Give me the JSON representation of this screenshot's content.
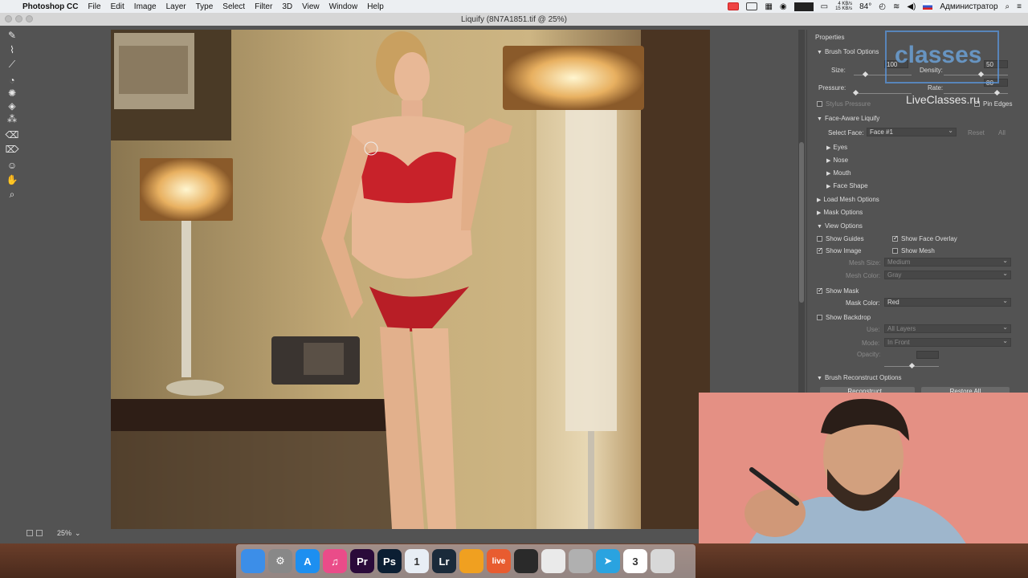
{
  "menubar": {
    "app_name": "Photoshop CC",
    "menus": [
      "File",
      "Edit",
      "Image",
      "Layer",
      "Type",
      "Select",
      "Filter",
      "3D",
      "View",
      "Window",
      "Help"
    ],
    "net_speed_up": "4 KB/s",
    "net_speed_down": "15 KB/s",
    "temperature": "84°",
    "user": "Администратор"
  },
  "window": {
    "title": "Liquify (8N7A1851.tif @ 25%)"
  },
  "zoom": {
    "value": "25%"
  },
  "panel": {
    "title": "Properties",
    "brush": {
      "header": "Brush Tool Options",
      "size_label": "Size:",
      "size_value": "100",
      "density_label": "Density:",
      "density_value": "50",
      "pressure_label": "Pressure:",
      "rate_label": "Rate:",
      "rate_value": "80",
      "stylus_label": "Stylus Pressure",
      "pin_edges_label": "Pin Edges"
    },
    "face_aware": {
      "header": "Face-Aware Liquify",
      "select_face_label": "Select Face:",
      "select_face_value": "Face #1",
      "reset_label": "Reset",
      "all_label": "All",
      "eyes": "Eyes",
      "nose": "Nose",
      "mouth": "Mouth",
      "face_shape": "Face Shape"
    },
    "load_mesh": "Load Mesh Options",
    "mask_options": "Mask Options",
    "view": {
      "header": "View Options",
      "show_guides": "Show Guides",
      "show_face_overlay": "Show Face Overlay",
      "show_image": "Show Image",
      "show_mesh": "Show Mesh",
      "mesh_size_label": "Mesh Size:",
      "mesh_size_value": "Medium",
      "mesh_color_label": "Mesh Color:",
      "mesh_color_value": "Gray",
      "show_mask": "Show Mask",
      "mask_color_label": "Mask Color:",
      "mask_color_value": "Red",
      "show_backdrop": "Show Backdrop",
      "use_label": "Use:",
      "use_value": "All Layers",
      "mode_label": "Mode:",
      "mode_value": "In Front",
      "opacity_label": "Opacity:"
    },
    "reconstruct": {
      "header": "Brush Reconstruct Options",
      "reconstruct_label": "Reconstruct...",
      "restore_all_label": "Restore All"
    }
  },
  "watermark": {
    "big": "classes",
    "url": "LiveClasses.ru"
  },
  "dock": {
    "items": [
      {
        "name": "finder-icon",
        "label": "",
        "color": "#3c8ee8"
      },
      {
        "name": "system-preferences-icon",
        "label": "⚙",
        "color": "#888888"
      },
      {
        "name": "app-store-icon",
        "label": "A",
        "color": "#1d8ff0"
      },
      {
        "name": "itunes-icon",
        "label": "♫",
        "color": "#ea4c89"
      },
      {
        "name": "premiere-icon",
        "label": "Pr",
        "color": "#2a0a3a"
      },
      {
        "name": "photoshop-icon",
        "label": "Ps",
        "color": "#0b1e33"
      },
      {
        "name": "onepassword-icon",
        "label": "1",
        "color": "#e8eef5"
      },
      {
        "name": "lightroom-icon",
        "label": "Lr",
        "color": "#1a2a3a"
      },
      {
        "name": "profile-icon",
        "label": "",
        "color": "#f0a020"
      },
      {
        "name": "live-icon",
        "label": "live",
        "color": "#e85c30"
      },
      {
        "name": "camera-icon",
        "label": "",
        "color": "#2a2a2a"
      },
      {
        "name": "chrome-icon",
        "label": "",
        "color": "#eaeaea"
      },
      {
        "name": "preview-icon",
        "label": "",
        "color": "#b0b0b0"
      },
      {
        "name": "telegram-icon",
        "label": "➤",
        "color": "#2aa3e0"
      },
      {
        "name": "calendar-icon",
        "label": "3",
        "color": "#ffffff"
      },
      {
        "name": "misc-icon",
        "label": "",
        "color": "#d8d8d8"
      }
    ]
  }
}
